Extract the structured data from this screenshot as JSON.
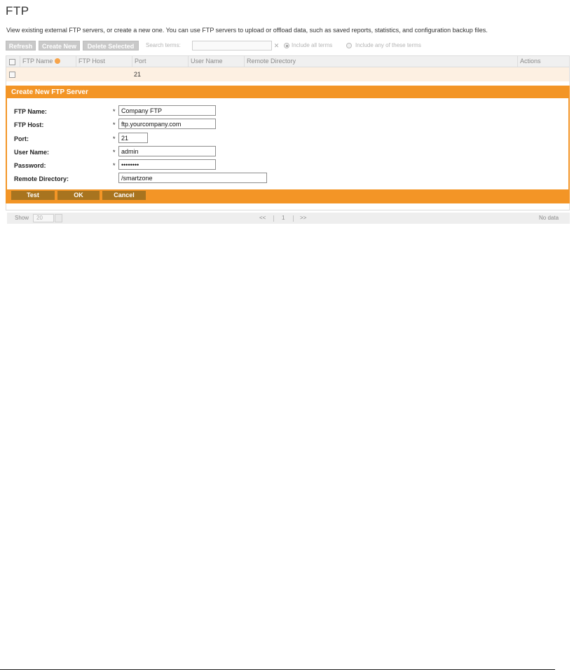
{
  "page": {
    "title": "FTP",
    "description": "View existing external FTP servers, or create a new one. You can use FTP servers to upload or offload data, such as saved reports, statistics, and configuration backup files."
  },
  "toolbar": {
    "refresh_label": "Refresh",
    "create_new_label": "Create New",
    "delete_selected_label": "Delete Selected",
    "search_label": "Search terms:",
    "search_value": "",
    "clear_icon": "x-icon",
    "radio_all_label": "Include all terms",
    "radio_any_label": "Include any of these terms",
    "radio_selected": "all"
  },
  "grid": {
    "columns": [
      "FTP Name",
      "FTP Host",
      "Port",
      "User Name",
      "Remote Directory",
      "Actions"
    ],
    "sort_column": "FTP Name",
    "rows": [
      {
        "ftp_name": "",
        "ftp_host": "",
        "port": "21",
        "user_name": "",
        "remote_directory": "",
        "actions": ""
      }
    ]
  },
  "form": {
    "title": "Create New FTP Server",
    "fields": [
      {
        "label": "FTP Name:",
        "required": "*",
        "value": "Company FTP"
      },
      {
        "label": "FTP Host:",
        "required": "*",
        "value": "ftp.yourcompany.com"
      },
      {
        "label": "Port:",
        "required": "*",
        "value": "21"
      },
      {
        "label": "User Name:",
        "required": "*",
        "value": "admin"
      },
      {
        "label": "Password:",
        "required": "*",
        "value": "••••••••"
      },
      {
        "label": "Remote Directory:",
        "required": "",
        "value": "/smartzone"
      }
    ],
    "buttons": {
      "test": "Test",
      "ok": "OK",
      "cancel": "Cancel"
    }
  },
  "pager": {
    "show_label": "Show",
    "page_size": "20",
    "first_prev": "<<",
    "page": "1",
    "next_last": ">>",
    "status": "No data"
  },
  "colors": {
    "accent": "#f39526",
    "button_dark": "#a8741f",
    "row_highlight": "#fdf0e2",
    "disabled_button": "#c9c9c9"
  }
}
